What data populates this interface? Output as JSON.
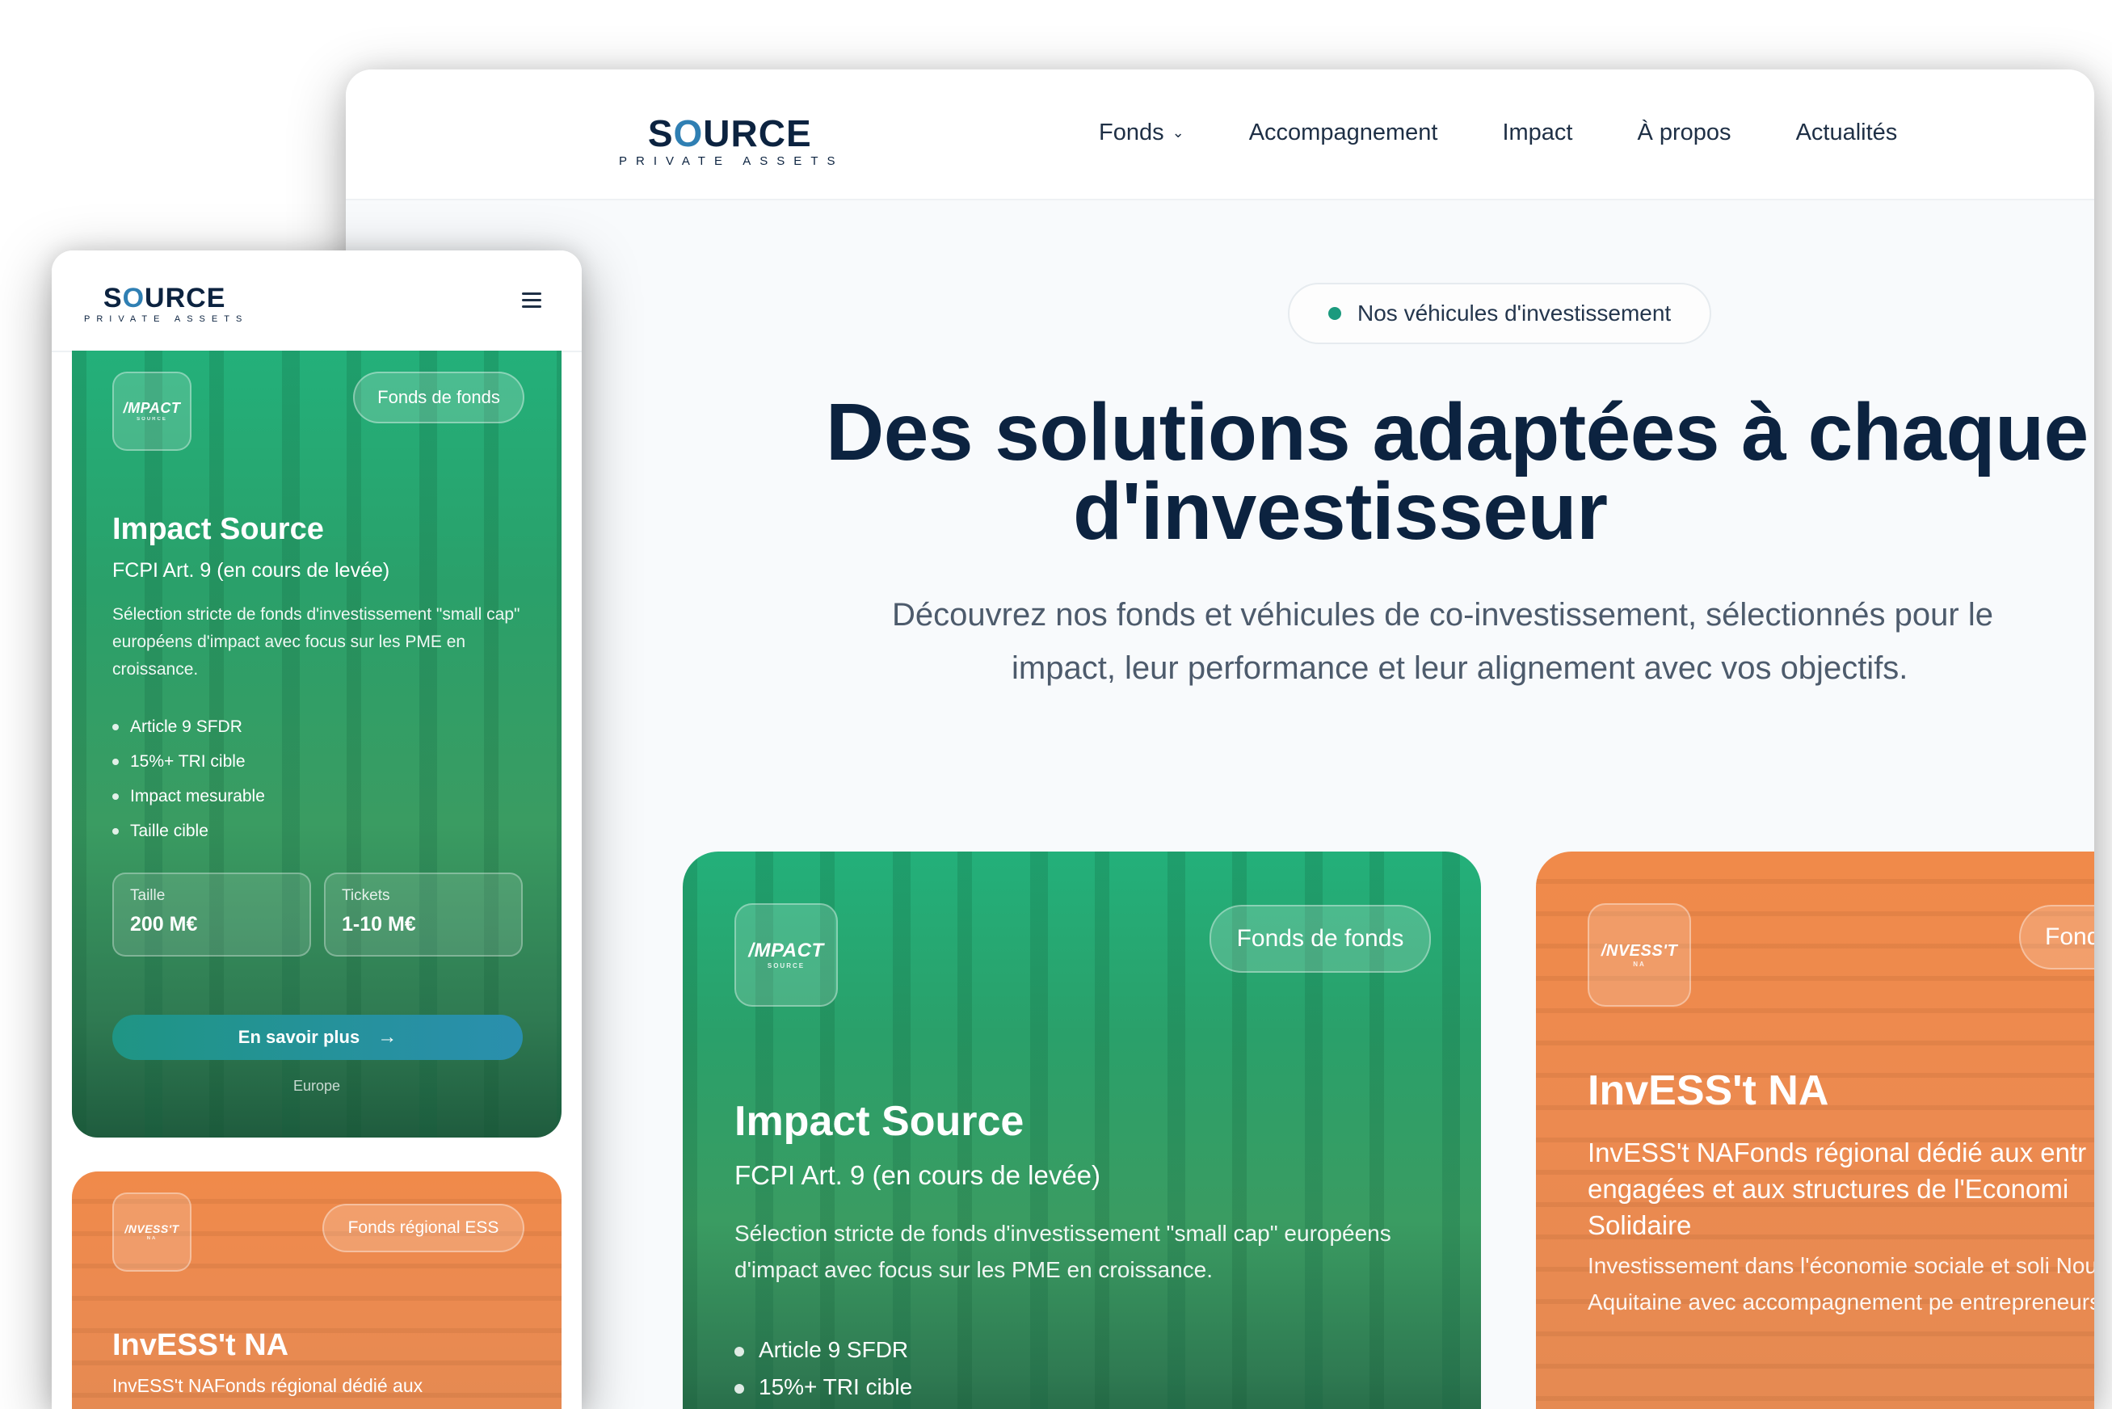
{
  "brand": {
    "name_pre": "S",
    "name_o": "O",
    "name_post": "URCE",
    "tagline": "PRIVATE ASSETS"
  },
  "nav": {
    "items": [
      {
        "label": "Fonds",
        "has_dropdown": true
      },
      {
        "label": "Accompagnement"
      },
      {
        "label": "Impact"
      },
      {
        "label": "À propos"
      },
      {
        "label": "Actualités"
      }
    ]
  },
  "hero": {
    "pill": "Nos véhicules d'investissement",
    "title_line1": "Des solutions adaptées à chaque p",
    "title_line2": "d'investisseur",
    "subtitle_line1": "Découvrez nos fonds et véhicules de co-investissement, sélectionnés pour le",
    "subtitle_line2": "impact, leur performance et leur alignement avec vos objectifs."
  },
  "cards": {
    "impact": {
      "logo_main": "/MPACT",
      "logo_sub": "SOURCE",
      "tag": "Fonds de fonds",
      "title": "Impact Source",
      "subtitle": "FCPI Art. 9 (en cours de levée)",
      "description": "Sélection stricte de fonds d'investissement \"small cap\" européens d'impact avec focus sur les PME en croissance.",
      "features": [
        "Article 9 SFDR",
        "15%+ TRI cible",
        "Impact mesurable",
        "Taille cible"
      ],
      "desktop_features_visible": [
        "Article 9 SFDR",
        "15%+ TRI cible"
      ],
      "stats": [
        {
          "label": "Taille",
          "value": "200 M€"
        },
        {
          "label": "Tickets",
          "value": "1-10 M€"
        }
      ],
      "cta": "En savoir plus",
      "region": "Europe"
    },
    "invesst": {
      "logo_main": "/NVESS'T",
      "logo_sub": "NA",
      "tag_desktop": "Fond",
      "tag_mobile": "Fonds régional ESS",
      "title": "InvESS't NA",
      "subtitle_desktop": "InvESS't NAFonds régional dédié aux entr engagées et aux structures de l'Economi Solidaire",
      "subtitle_mobile": "InvESS't NAFonds régional dédié aux",
      "description": "Investissement dans l'économie sociale et soli Nouvelle-Aquitaine avec accompagnement pe entrepreneurs."
    }
  },
  "colors": {
    "navy": "#0c2340",
    "accent_blue": "#2f7fb3",
    "teal": "#1b9a7e",
    "card_green": "#2aa06a",
    "card_orange": "#ec8a50"
  },
  "icons": {
    "dropdown": "chevron-down-icon",
    "menu": "hamburger-icon",
    "cta_arrow": "arrow-right-icon"
  }
}
